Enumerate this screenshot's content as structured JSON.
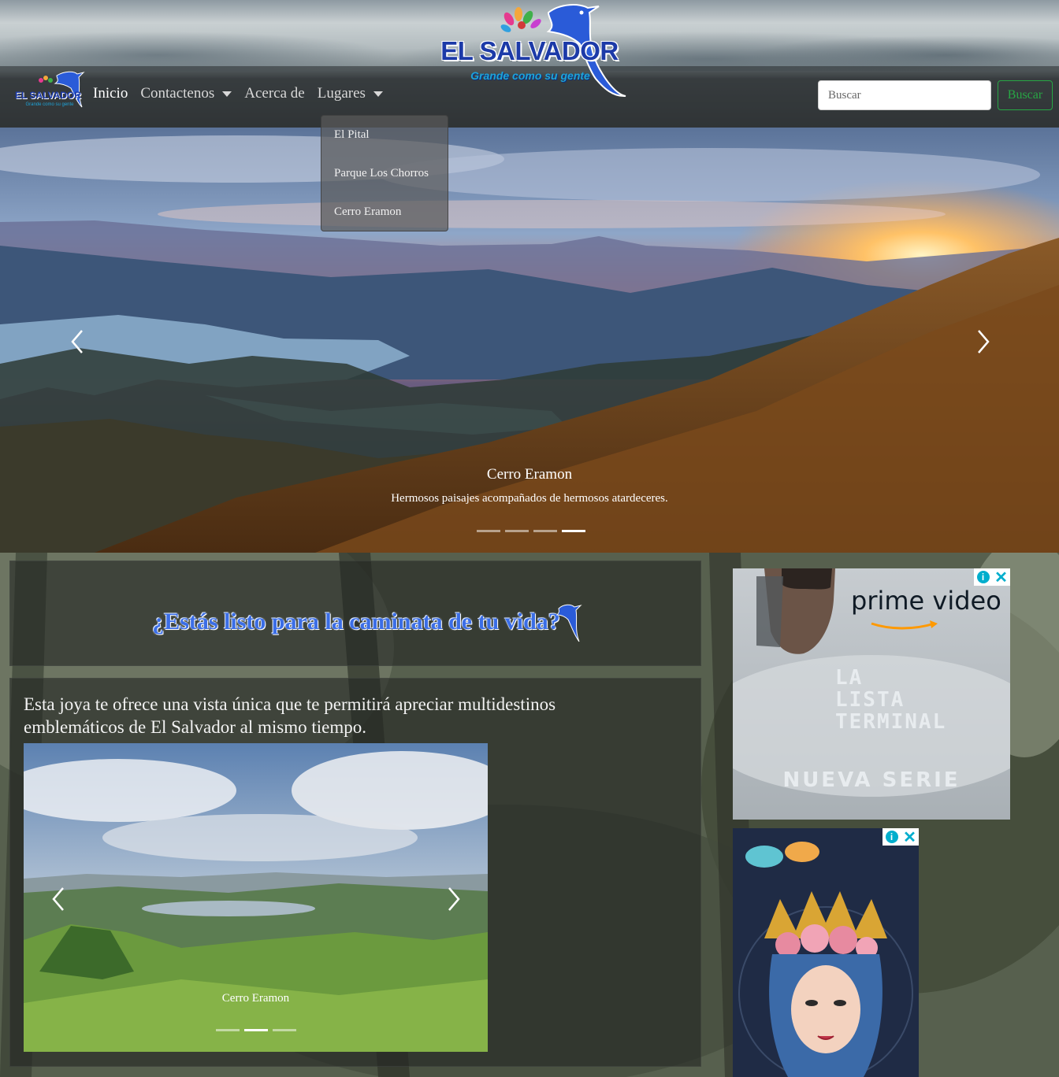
{
  "header": {
    "brand_title": "EL SALVADOR",
    "brand_slogan": "Grande como su gente",
    "logo_small_title": "EL SALVADOR",
    "logo_small_slogan": "Grande como su gente"
  },
  "nav": {
    "items": [
      {
        "label": "Inicio",
        "active": true,
        "dropdown": false
      },
      {
        "label": "Contactenos",
        "active": false,
        "dropdown": true
      },
      {
        "label": "Acerca de",
        "active": false,
        "dropdown": false
      },
      {
        "label": "Lugares",
        "active": false,
        "dropdown": true
      }
    ],
    "lugares_dropdown": [
      "El Pital",
      "Parque Los Chorros",
      "Cerro Eramon"
    ]
  },
  "search": {
    "placeholder": "Buscar",
    "button_label": "Buscar",
    "button_color": "#28a745"
  },
  "hero_carousel": {
    "caption_title": "Cerro Eramon",
    "caption_text": "Hermosos paisajes acompañados de hermosos atardeceres.",
    "slide_count": 4,
    "active_slide": 4
  },
  "main": {
    "heading": "¿Estás listo para la caminata de tu vida?",
    "intro_text": "Esta joya te ofrece una vista única que te permitirá apreciar multidestinos emblemáticos de El Salvador al mismo tiempo.",
    "inner_carousel": {
      "caption": "Cerro Eramon",
      "slide_count": 3,
      "active_slide": 2
    }
  },
  "ads": {
    "ad1": {
      "brand": "prime video",
      "series_title": [
        "LA",
        "LISTA",
        "TERMINAL"
      ],
      "tagline": "NUEVA SERIE",
      "info_icon": "info-icon",
      "close_icon": "close-icon"
    },
    "ad2": {
      "info_icon": "info-icon",
      "close_icon": "close-icon"
    }
  },
  "colors": {
    "brand_blue": "#1c3aa8",
    "accent_cyan": "#1ea3d8",
    "heading_blue": "#3b6ee6",
    "ad_icon_cyan": "#00aecd"
  }
}
